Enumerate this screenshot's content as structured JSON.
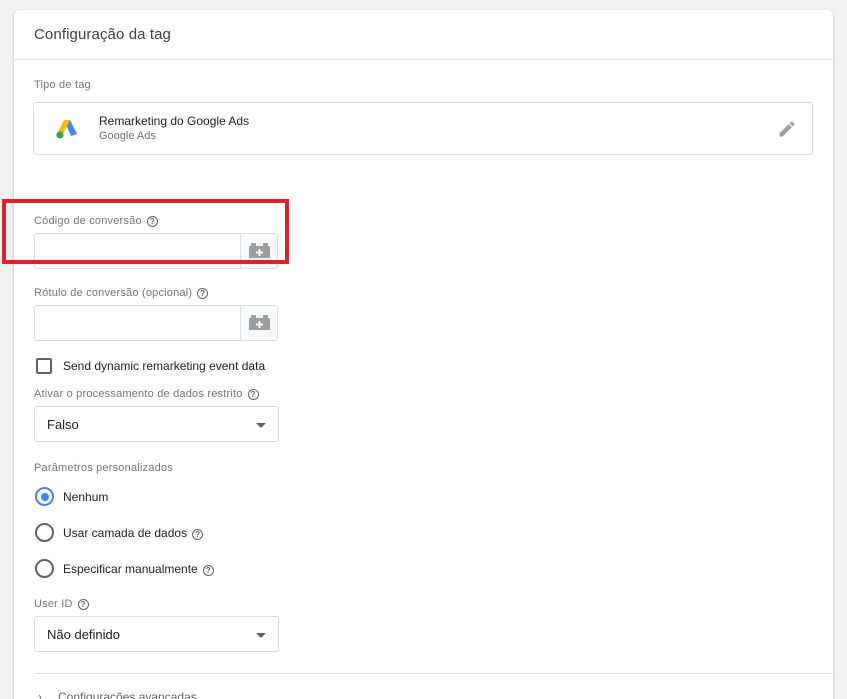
{
  "card": {
    "title": "Configuração da tag"
  },
  "tag_type": {
    "section_label": "Tipo de tag",
    "name": "Remarketing do Google Ads",
    "subtitle": "Google Ads",
    "logo_icon": "google-ads-logo",
    "edit_icon": "pencil-icon"
  },
  "conversion_code": {
    "label": "Código de conversão",
    "value": "",
    "variable_icon": "variable-picker-icon"
  },
  "conversion_label": {
    "label": "Rótulo de conversão (opcional)",
    "value": "",
    "variable_icon": "variable-picker-icon"
  },
  "dynamic_remarketing": {
    "label": "Send dynamic remarketing event data",
    "checked": false
  },
  "restricted_processing": {
    "label": "Ativar o processamento de dados restrito",
    "selected": "Falso"
  },
  "custom_params": {
    "label": "Parâmetros personalizados",
    "options": [
      {
        "label": "Nenhum",
        "checked": true,
        "help": false
      },
      {
        "label": "Usar camada de dados",
        "checked": false,
        "help": true
      },
      {
        "label": "Especificar manualmente",
        "checked": false,
        "help": true
      }
    ]
  },
  "user_id": {
    "label": "User ID",
    "selected": "Não definido"
  },
  "advanced": {
    "label": "Configurações avançadas"
  },
  "help_glyph": "?",
  "colors": {
    "highlight": "#e0212b",
    "radio_selected": "#4285f4",
    "ads_blue": "#4285f4",
    "ads_yellow": "#fbbc04",
    "ads_green": "#34a853"
  }
}
